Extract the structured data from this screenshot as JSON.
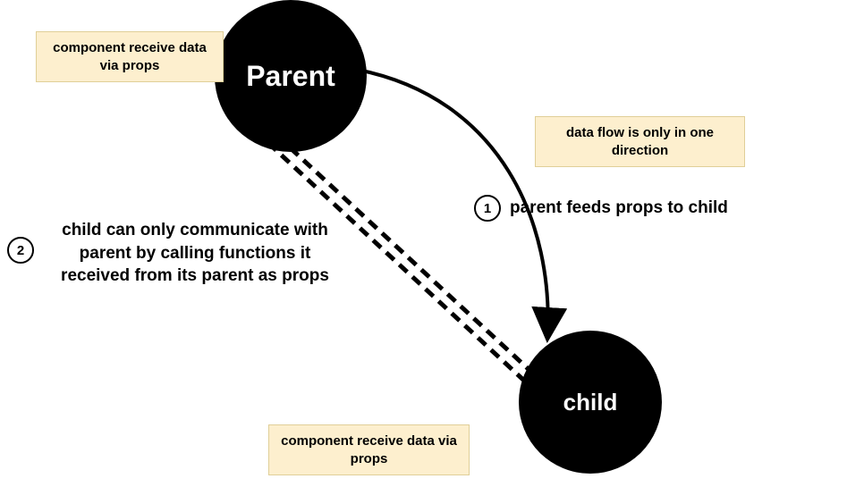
{
  "nodes": {
    "parent": "Parent",
    "child": "child"
  },
  "notes": {
    "parent_note": "component receive data via props",
    "flow_note": "data flow is only in one direction",
    "child_note": "component receive data via props"
  },
  "steps": {
    "s1": {
      "num": "1",
      "text": "parent feeds props to child"
    },
    "s2": {
      "num": "2",
      "text": "child can only communicate with parent by calling functions it received from its parent as props"
    }
  }
}
